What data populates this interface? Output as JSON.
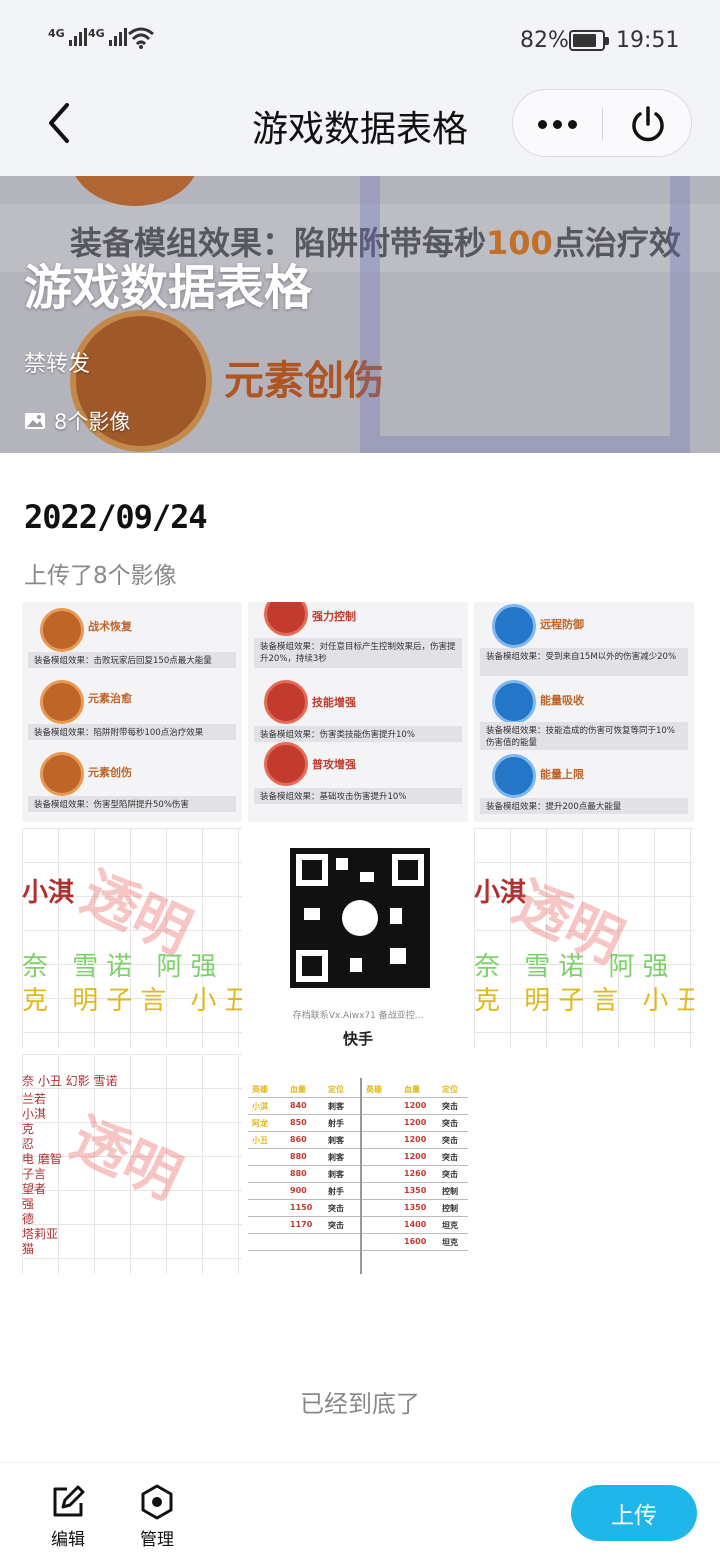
{
  "status_bar": {
    "signal1_label": "4G",
    "signal2_label": "4G",
    "battery_percent": "82%",
    "battery_level": 0.82,
    "time": "19:51"
  },
  "nav": {
    "title": "游戏数据表格",
    "back_icon": "chevron-left-icon",
    "more_icon": "more-dots-icon",
    "power_icon": "power-icon"
  },
  "hero": {
    "title": "游戏数据表格",
    "subtitle": "禁转发",
    "image_count": "8个影像",
    "bg_equip_text_pre": "装备模组效果：陷阱附带每秒",
    "bg_equip_text_num": "100",
    "bg_equip_text_post": "点治疗效",
    "bg_elem_text": "元素创伤"
  },
  "section": {
    "date": "2022/09/24",
    "upload_desc": "上传了8个影像"
  },
  "thumbs": {
    "t1": [
      {
        "name": "战术恢复",
        "desc": "装备模组效果：击败玩家后回复150点最大能量"
      },
      {
        "name": "元素治愈",
        "desc": "装备模组效果：陷阱附带每秒100点治疗效果"
      },
      {
        "name": "元素创伤",
        "desc": "装备模组效果：伤害型陷阱提升50%伤害"
      }
    ],
    "t2": [
      {
        "name": "强力控制",
        "desc": "装备模组效果：对任意目标产生控制效果后，伤害提升20%，持续3秒"
      },
      {
        "name": "技能增强",
        "desc": "装备模组效果：伤害类技能伤害提升10%"
      },
      {
        "name": "普攻增强",
        "desc": "装备模组效果：基础攻击伤害提升10%"
      }
    ],
    "t3": [
      {
        "name": "远程防御",
        "desc": "装备模组效果：受到来自15M以外的伤害减少20%"
      },
      {
        "name": "能量吸收",
        "desc": "装备模组效果：技能造成的伤害可恢复等同于10%伤害值的能量"
      },
      {
        "name": "能量上限",
        "desc": "装备模组效果：提升200点最大能量"
      }
    ],
    "t4": {
      "red": "小淇",
      "names_a": "奈 雪诺 阿强",
      "names_b": "克 明子言 小丑",
      "wm": "透明"
    },
    "t5": {
      "caption": "存档联系Vx.Aiwx71 备战亚控...",
      "logo": "快手"
    },
    "t6": {
      "red": "小淇",
      "names_a": "奈 雪诺 阿强",
      "names_b": "克 明子言 小丑",
      "wm": "透明"
    },
    "t7": {
      "header": "奈  小丑  幻影  雪诺",
      "rows": [
        "兰若",
        "小淇",
        "克",
        "忍",
        "电  磨智",
        "子言",
        "望者",
        "强",
        "德",
        "塔莉亚",
        "猫"
      ],
      "wm": "透明"
    },
    "t8": {
      "headers": [
        "英雄",
        "血量",
        "定位",
        "英雄",
        "血量",
        "定位"
      ],
      "rows": [
        [
          "小淇",
          "840",
          "刺客",
          "",
          "1200",
          "突击"
        ],
        [
          "阿龙",
          "850",
          "射手",
          "",
          "1200",
          "突击"
        ],
        [
          "小丑",
          "860",
          "刺客",
          "",
          "1200",
          "突击"
        ],
        [
          "",
          "880",
          "刺客",
          "",
          "1200",
          "突击"
        ],
        [
          "",
          "880",
          "刺客",
          "",
          "1260",
          "突击"
        ],
        [
          "",
          "900",
          "射手",
          "",
          "1350",
          "控制"
        ],
        [
          "",
          "1150",
          "突击",
          "",
          "1350",
          "控制"
        ],
        [
          "",
          "1170",
          "突击",
          "",
          "1400",
          "坦克"
        ],
        [
          "",
          "",
          "",
          "",
          "1600",
          "坦克"
        ]
      ]
    }
  },
  "end_text": "已经到底了",
  "toolbar": {
    "edit_label": "编辑",
    "manage_label": "管理",
    "upload_label": "上传"
  },
  "colors": {
    "accent": "#1fb7e9",
    "nav_bg": "#f3f4f7"
  }
}
